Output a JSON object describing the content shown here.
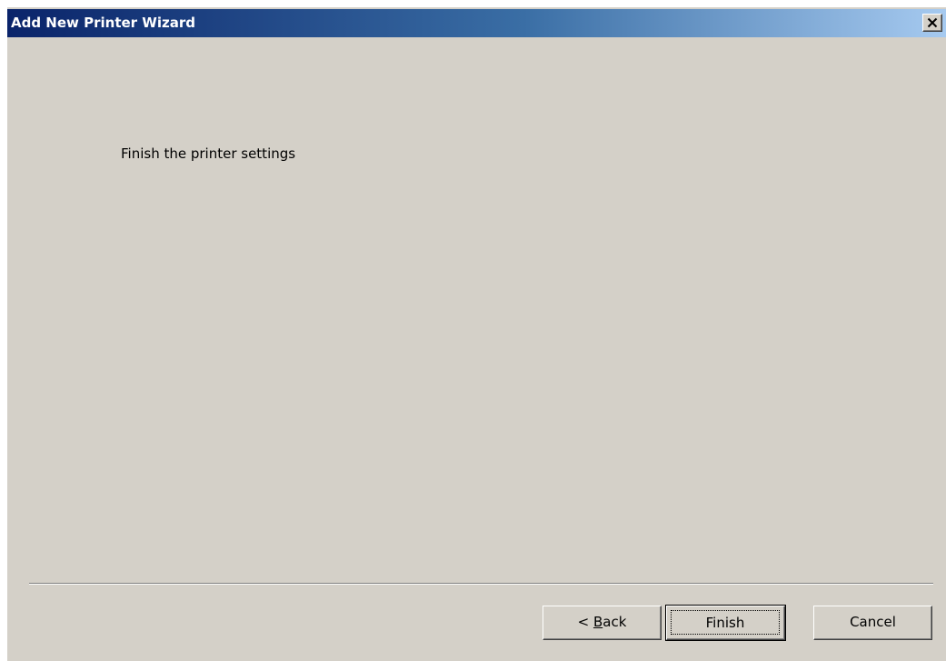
{
  "window": {
    "title": "Add New Printer Wizard",
    "close_glyph": "✕",
    "colors": {
      "titlebar_start": "#0a246a",
      "titlebar_end": "#a6caf0",
      "face": "#d4d0c8"
    }
  },
  "content": {
    "heading": "Finish the printer settings"
  },
  "buttons": {
    "back_prefix": "< ",
    "back_accel": "B",
    "back_rest": "ack",
    "finish_label": "Finish",
    "cancel_label": "Cancel"
  },
  "icons": {
    "close": "close-icon"
  }
}
